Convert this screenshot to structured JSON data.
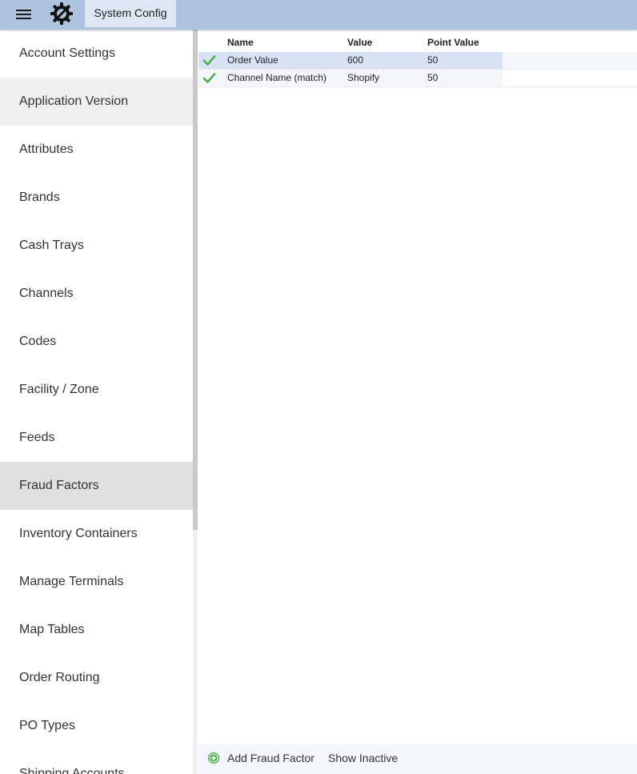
{
  "header": {
    "menu_icon": "hamburger-menu-icon",
    "logo_icon": "gear-wrench-logo-icon",
    "title": "System Config",
    "bar_color": "#adc3e0"
  },
  "sidebar": {
    "items": [
      {
        "label": "Account Settings"
      },
      {
        "label": "Application Version"
      },
      {
        "label": "Attributes"
      },
      {
        "label": "Brands"
      },
      {
        "label": "Cash Trays"
      },
      {
        "label": "Channels"
      },
      {
        "label": "Codes"
      },
      {
        "label": "Facility / Zone"
      },
      {
        "label": "Feeds"
      },
      {
        "label": "Fraud Factors"
      },
      {
        "label": "Inventory Containers"
      },
      {
        "label": "Manage Terminals"
      },
      {
        "label": "Map Tables"
      },
      {
        "label": "Order Routing"
      },
      {
        "label": "PO Types"
      },
      {
        "label": "Shipping Accounts"
      }
    ],
    "active": "Fraud Factors",
    "hover": "Application Version"
  },
  "grid": {
    "columns": {
      "name": "Name",
      "value": "Value",
      "point_value": "Point Value"
    },
    "rows": [
      {
        "status_icon": "check-icon",
        "name": "Order Value",
        "value": "600",
        "point_value": "50"
      },
      {
        "status_icon": "check-icon",
        "name": "Channel Name (match)",
        "value": "Shopify",
        "point_value": "50"
      }
    ],
    "check_color": "#4caf50"
  },
  "footer": {
    "add_label": "Add Fraud Factor",
    "add_icon": "plus-circle-icon",
    "add_icon_color": "#4caf50",
    "show_inactive_label": "Show Inactive"
  }
}
